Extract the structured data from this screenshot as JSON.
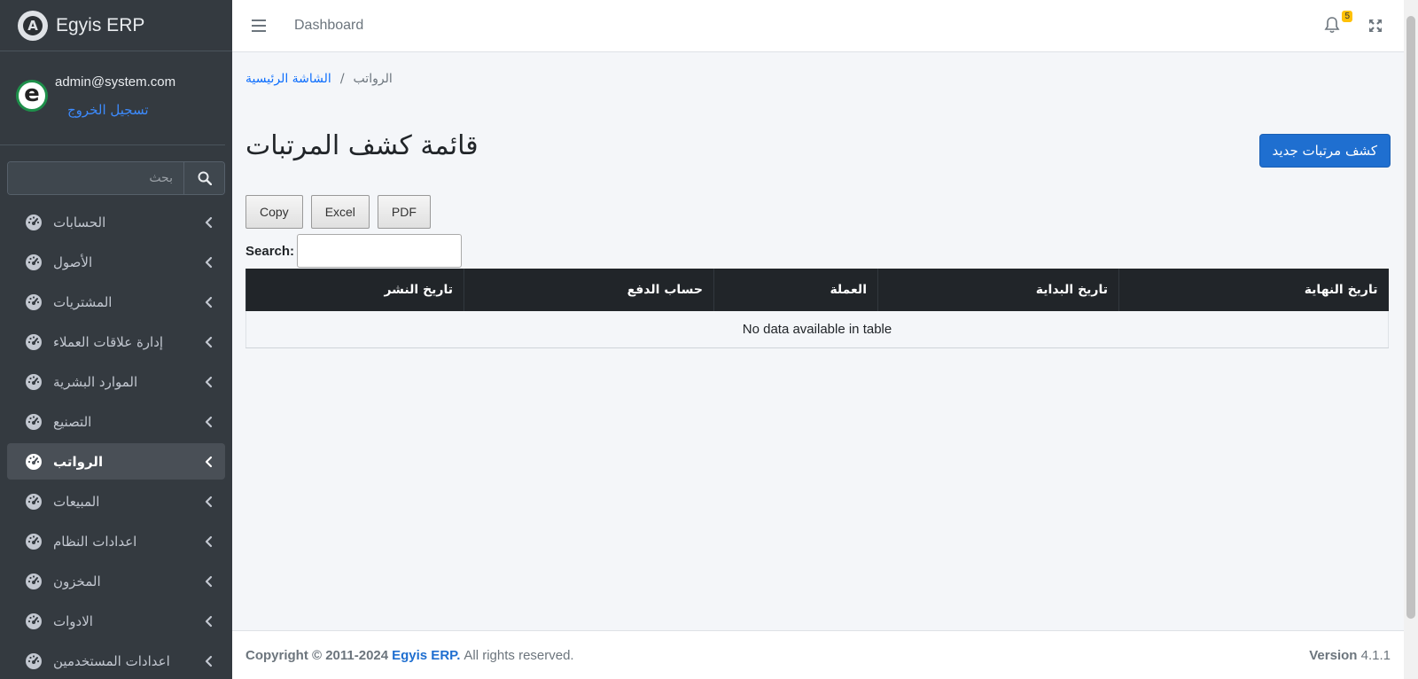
{
  "brand": {
    "name": "Egyis ERP",
    "logo_letter": "A"
  },
  "user": {
    "avatar_letter": "e",
    "email": "admin@system.com",
    "logout_label": "تسجيل الخروج"
  },
  "sidebar_search": {
    "placeholder": "بحث"
  },
  "sidebar": {
    "items": [
      {
        "label": "الحسابات",
        "active": false
      },
      {
        "label": "الأصول",
        "active": false
      },
      {
        "label": "المشتريات",
        "active": false
      },
      {
        "label": "إدارة علاقات العملاء",
        "active": false
      },
      {
        "label": "الموارد البشرية",
        "active": false
      },
      {
        "label": "التصنيع",
        "active": false
      },
      {
        "label": "الرواتب",
        "active": true
      },
      {
        "label": "المبيعات",
        "active": false
      },
      {
        "label": "اعدادات النظام",
        "active": false
      },
      {
        "label": "المخزون",
        "active": false
      },
      {
        "label": "الادوات",
        "active": false
      },
      {
        "label": "اعدادات المستخدمين",
        "active": false
      }
    ]
  },
  "topbar": {
    "dashboard_label": "Dashboard",
    "notification_count": "5"
  },
  "breadcrumb": {
    "home": "الشاشة الرئيسية",
    "separator": "/",
    "current": "الرواتب"
  },
  "page": {
    "title": "قائمة كشف المرتبات",
    "new_button": "كشف مرتبات جديد"
  },
  "datatable": {
    "buttons": [
      "Copy",
      "Excel",
      "PDF"
    ],
    "search_label": "Search:",
    "columns": [
      "تاريخ النشر",
      "حساب الدفع",
      "العملة",
      "تاريخ البداية",
      "تاريخ النهاية"
    ],
    "empty_message": "No data available in table"
  },
  "footer": {
    "copyright": "Copyright © 2011-2024",
    "brand": "Egyis ERP.",
    "rights": "All rights reserved.",
    "version_label": "Version",
    "version_number": "4.1.1"
  },
  "colors": {
    "sidebar_bg": "#343a40",
    "primary": "#1f6fd0",
    "table_header": "#212529",
    "badge": "#ffc107"
  }
}
